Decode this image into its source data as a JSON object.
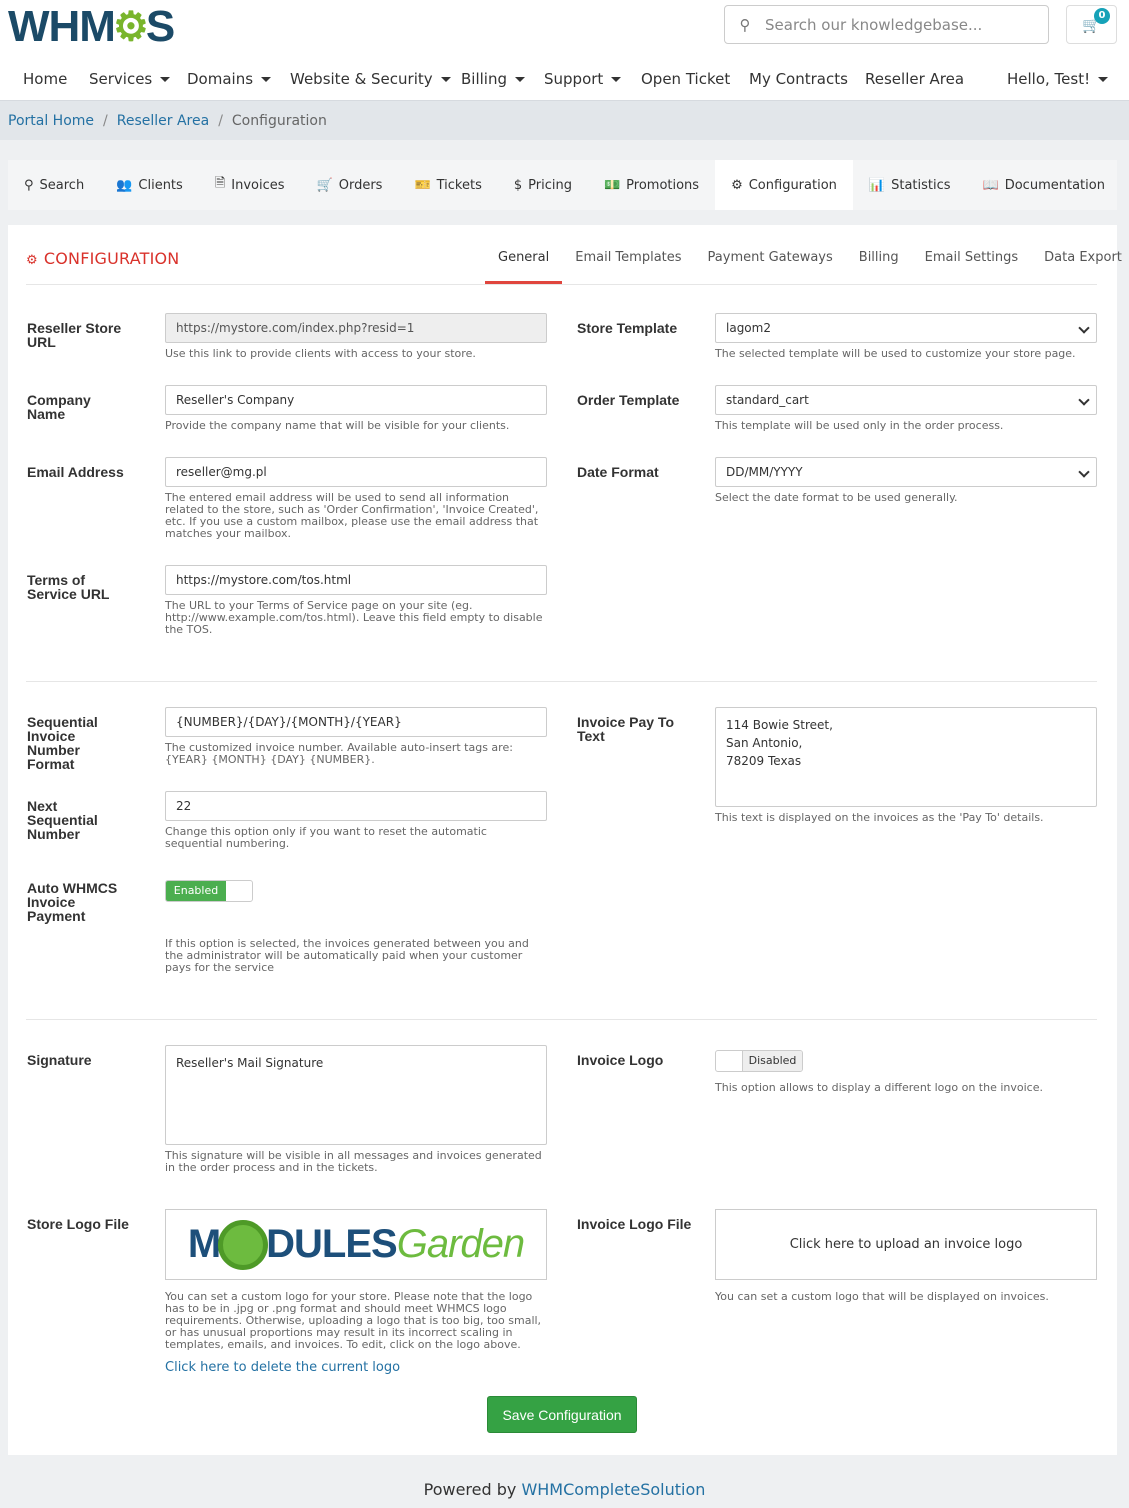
{
  "brand": {
    "logo_left": "WHM",
    "logo_right": "S"
  },
  "search": {
    "placeholder": "Search our knowledgebase..."
  },
  "cart": {
    "count": "0"
  },
  "nav": {
    "home": "Home",
    "services": "Services",
    "domains": "Domains",
    "website_security": "Website & Security",
    "billing": "Billing",
    "support": "Support",
    "open_ticket": "Open Ticket",
    "my_contracts": "My Contracts",
    "reseller_area": "Reseller Area",
    "user": "Hello, Test!"
  },
  "breadcrumb": {
    "home": "Portal Home",
    "reseller": "Reseller Area",
    "current": "Configuration"
  },
  "tabs": {
    "search": "Search",
    "clients": "Clients",
    "invoices": "Invoices",
    "orders": "Orders",
    "tickets": "Tickets",
    "pricing": "Pricing",
    "promotions": "Promotions",
    "configuration": "Configuration",
    "statistics": "Statistics",
    "documentation": "Documentation"
  },
  "panel": {
    "title": "CONFIGURATION",
    "subtabs": {
      "general": "General",
      "email_templates": "Email Templates",
      "payment_gateways": "Payment Gateways",
      "billing": "Billing",
      "email_settings": "Email Settings",
      "data_export": "Data Export"
    }
  },
  "form": {
    "store_url": {
      "label": "Reseller Store URL",
      "value": "https://mystore.com/index.php?resid=1",
      "help": "Use this link to provide clients with access to your store."
    },
    "company": {
      "label": "Company Name",
      "value": "Reseller's Company",
      "help": "Provide the company name that will be visible for your clients."
    },
    "email": {
      "label": "Email Address",
      "value": "reseller@mg.pl",
      "help": "The entered email address will be used to send all information related to the store, such as 'Order Confirmation', 'Invoice Created', etc. If you use a custom mailbox, please use the email address that matches your mailbox."
    },
    "tos": {
      "label": "Terms of Service URL",
      "value": "https://mystore.com/tos.html",
      "help": "The URL to your Terms of Service page on your site (eg. http://www.example.com/tos.html). Leave this field empty to disable the TOS."
    },
    "store_template": {
      "label": "Store Template",
      "value": "lagom2",
      "help": "The selected template will be used to customize your store page."
    },
    "order_template": {
      "label": "Order Template",
      "value": "standard_cart",
      "help": "This template will be used only in the order process."
    },
    "date_format": {
      "label": "Date Format",
      "value": "DD/MM/YYYY",
      "help": "Select the date format to be used generally."
    },
    "seq_format": {
      "label": "Sequential Invoice Number Format",
      "value": "{NUMBER}/{DAY}/{MONTH}/{YEAR}",
      "help": "The customized invoice number. Available auto-insert tags are: {YEAR} {MONTH} {DAY} {NUMBER}."
    },
    "next_seq": {
      "label": "Next Sequential Number",
      "value": "22",
      "help": "Change this option only if you want to reset the automatic sequential numbering."
    },
    "auto_payment": {
      "label": "Auto WHMCS Invoice Payment",
      "state": "Enabled",
      "help": "If this option is selected, the invoices generated between you and the administrator will be automatically paid when your customer pays for the service"
    },
    "pay_to": {
      "label": "Invoice Pay To Text",
      "value": "114 Bowie Street,\nSan Antonio,\n78209 Texas",
      "help": "This text is displayed on the invoices as the 'Pay To' details."
    },
    "signature": {
      "label": "Signature",
      "value": "Reseller's Mail Signature",
      "help": "This signature will be visible in all messages and invoices generated in the order process and in the tickets."
    },
    "invoice_logo": {
      "label": "Invoice Logo",
      "state": "Disabled",
      "help": "This option allows to display a different logo on the invoice."
    },
    "store_logo": {
      "label": "Store Logo File",
      "logo_left": "M",
      "logo_mid": "DULES",
      "logo_right": "Garden",
      "help": "You can set a custom logo for your store. Please note that the logo has to be in .jpg or .png format and should meet WHMCS logo requirements. Otherwise, uploading a logo that is too big, too small, or has unusual proportions may result in its incorrect scaling in templates, emails, and invoices. To edit, click on the logo above.",
      "delete_link": "Click here to delete the current logo"
    },
    "invoice_logo_file": {
      "label": "Invoice Logo File",
      "upload": "Click here to upload an invoice logo",
      "help": "You can set a custom logo that will be displayed on invoices."
    },
    "save": "Save Configuration"
  },
  "footer": {
    "prefix": "Powered by",
    "link": "WHMCompleteSolution"
  }
}
